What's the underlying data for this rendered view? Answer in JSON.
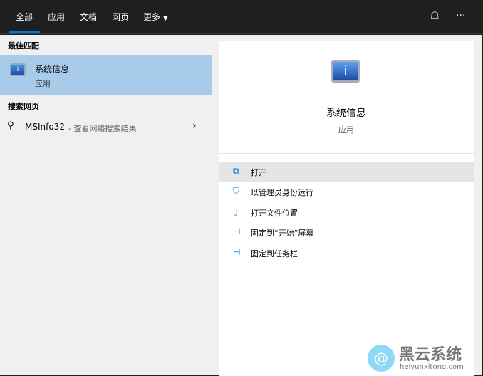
{
  "tabs": [
    {
      "label": "全部",
      "active": true
    },
    {
      "label": "应用"
    },
    {
      "label": "文档"
    },
    {
      "label": "网页"
    },
    {
      "label": "更多"
    }
  ],
  "top_icons": [
    "feedback-icon",
    "more-icon"
  ],
  "left": {
    "best_match_header": "最佳匹配",
    "best_match": {
      "title": "系统信息",
      "subtitle": "应用",
      "icon": "system-information-icon"
    },
    "web_header": "搜索网页",
    "web_item": {
      "query": "MSInfo32",
      "suffix": " - 查看网络搜索结果"
    }
  },
  "detail": {
    "title": "系统信息",
    "subtitle": "应用",
    "actions": [
      {
        "label": "打开",
        "icon": "open-icon"
      },
      {
        "label": "以管理员身份运行",
        "icon": "shield-icon"
      },
      {
        "label": "打开文件位置",
        "icon": "folder-icon"
      },
      {
        "label": "固定到“开始”屏幕",
        "icon": "pin-icon"
      },
      {
        "label": "固定到任务栏",
        "icon": "pin-icon"
      }
    ]
  },
  "watermark": {
    "name": "黑云系统",
    "url": "heiyunxitong.com"
  },
  "colors": {
    "accent": "#0078d7",
    "selected": "#a8cbea"
  }
}
